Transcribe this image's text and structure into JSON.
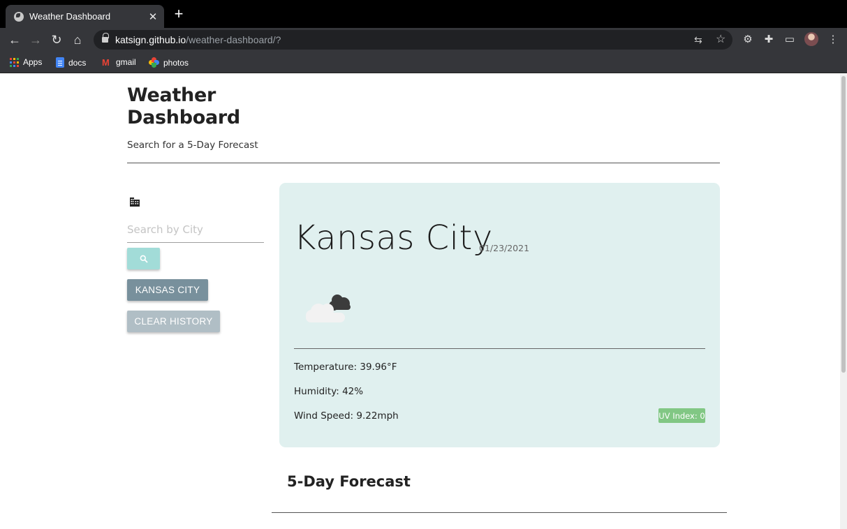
{
  "browser": {
    "tab_title": "Weather Dashboard",
    "url_host": "katsign.github.io",
    "url_path": "/weather-dashboard/?",
    "bookmarks": [
      "Apps",
      "docs",
      "gmail",
      "photos"
    ]
  },
  "header": {
    "title": "Weather Dashboard",
    "subtitle": "Search for a 5-Day Forecast"
  },
  "sidebar": {
    "search_placeholder": "Search by City",
    "search_value": "",
    "history": [
      "KANSAS CITY"
    ],
    "clear_label": "CLEAR HISTORY"
  },
  "current": {
    "city": "Kansas City",
    "date": "01/23/2021",
    "icon": "broken-clouds-icon",
    "temperature": "Temperature: 39.96°F",
    "humidity": "Humidity: 42%",
    "wind": "Wind Speed: 9.22mph",
    "uv": "UV Index: 0"
  },
  "forecast": {
    "title": "5-Day Forecast"
  },
  "colors": {
    "card_bg": "#e0f0ef",
    "search_button": "#a2dcd8",
    "history_button": "#78909c",
    "clear_button": "#b0bec5",
    "uv_badge": "#81c784"
  }
}
